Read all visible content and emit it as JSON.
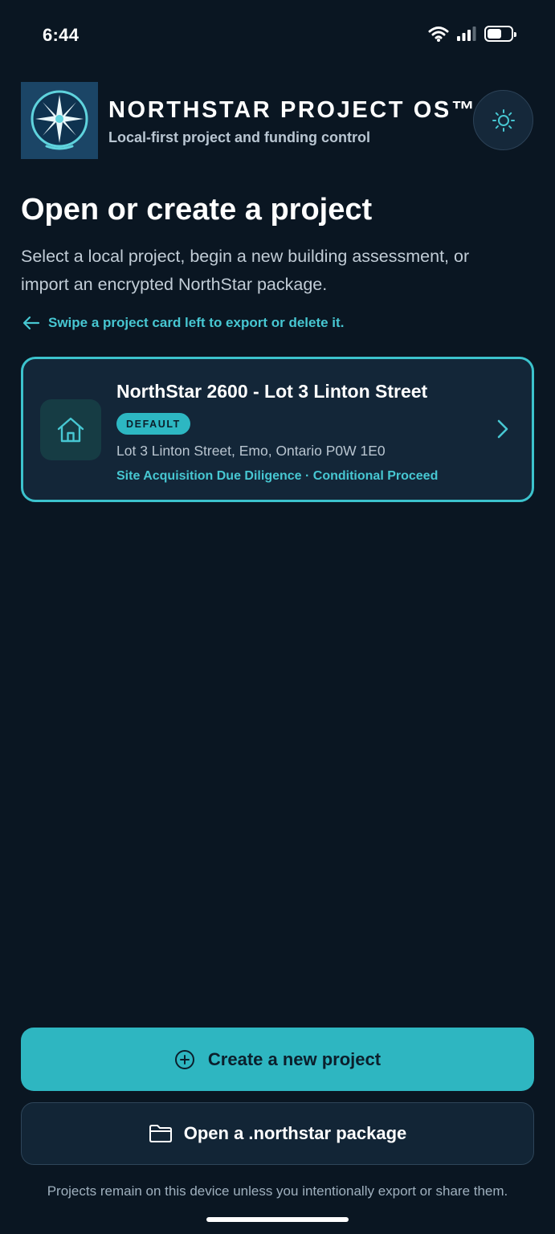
{
  "status_bar": {
    "time": "6:44",
    "icons": [
      "wifi-icon",
      "cellular-signal-icon",
      "battery-icon"
    ],
    "battery_level": 0.6
  },
  "header": {
    "logo_icon": "compass-star-logo",
    "title": "NORTHSTAR PROJECT OS™",
    "subtitle": "Local-first project and funding control",
    "theme_icon": "sun-icon"
  },
  "main": {
    "title": "Open or create a project",
    "description": "Select a local project, begin a new building assessment, or import an encrypted NorthStar package.",
    "swipe_hint": "Swipe a project card left to export or delete it."
  },
  "projects": [
    {
      "name": "NorthStar 2600 - Lot 3 Linton Street",
      "badge": "DEFAULT",
      "address": "Lot 3 Linton Street, Emo, Ontario P0W 1E0",
      "status": "Site Acquisition Due Diligence · Conditional Proceed",
      "icon": "house-icon"
    }
  ],
  "actions": {
    "create_label": "Create a new project",
    "open_label": "Open a .northstar package"
  },
  "footer": {
    "note": "Projects remain on this device unless you intentionally export or share them."
  },
  "colors": {
    "background": "#0a1622",
    "accent": "#2eb6c1",
    "card_border": "#3cc3cd",
    "card_background": "#132638",
    "muted_text": "#b9c6d2"
  }
}
